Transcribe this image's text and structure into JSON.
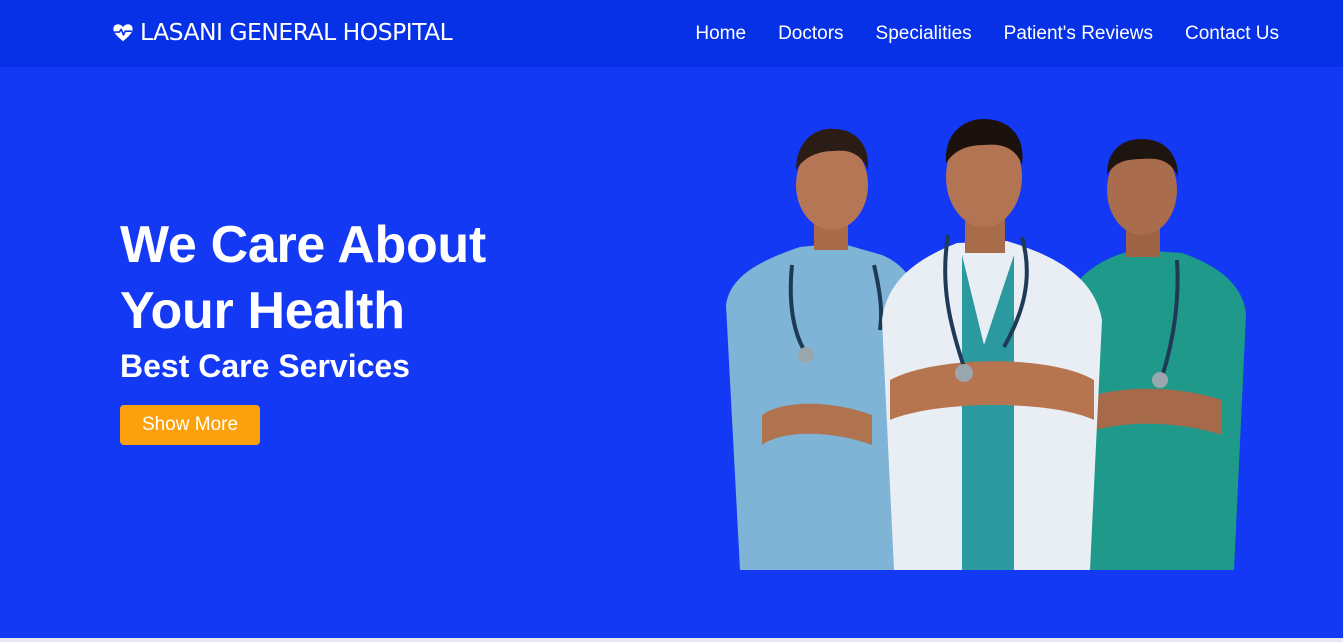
{
  "brand": {
    "name": "LASANI GENERAL HOSPITAL",
    "icon": "heart-pulse-icon"
  },
  "nav": {
    "items": [
      {
        "label": "Home"
      },
      {
        "label": "Doctors"
      },
      {
        "label": "Specialities"
      },
      {
        "label": "Patient's Reviews"
      },
      {
        "label": "Contact Us"
      }
    ]
  },
  "hero": {
    "title_line1": "We Care About",
    "title_line2": "Your Health",
    "subtitle": "Best Care Services",
    "cta_label": "Show More",
    "image": "three-doctors-photo"
  },
  "colors": {
    "navbar_bg": "#0631e6",
    "hero_bg": "#1339f5",
    "cta_bg": "#fca10b",
    "text": "#ffffff"
  }
}
